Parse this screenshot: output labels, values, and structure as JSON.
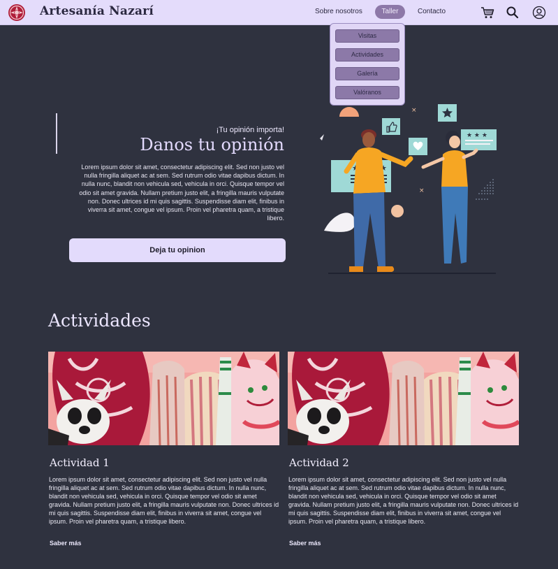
{
  "header": {
    "brand": "Artesanía Nazarí",
    "nav": [
      "Sobre nosotros",
      "Taller",
      "Contacto"
    ],
    "icons": [
      "cart-icon",
      "search-icon",
      "user-icon"
    ]
  },
  "dropdown": {
    "items": [
      "Visitas",
      "Actividades",
      "Galería",
      "Valóranos"
    ]
  },
  "hero": {
    "kicker": "¡Tu opinión importa!",
    "title": "Danos tu opinión",
    "text": "Lorem ipsum dolor sit amet, consectetur adipiscing elit. Sed non justo vel nulla fringilla aliquet ac at sem. Sed rutrum odio vitae dapibus dictum. In nulla nunc, blandit non vehicula sed, vehicula in orci. Quisque tempor vel odio sit amet gravida. Nullam pretium justo elit, a fringilla mauris vulputate non. Donec ultrices id mi quis sagittis. Suspendisse diam elit, finibus in viverra sit amet, congue vel ipsum. Proin vel pharetra quam, a tristique libero.",
    "cta": "Deja tu opinion"
  },
  "activities": {
    "title": "Actividades",
    "cards": [
      {
        "title": "Actividad 1",
        "text": "Lorem ipsum dolor sit amet, consectetur adipiscing elit. Sed non justo vel nulla fringilla aliquet ac at sem. Sed rutrum odio vitae dapibus dictum. In nulla nunc, blandit non vehicula sed, vehicula in orci. Quisque tempor vel odio sit amet gravida. Nullam pretium justo elit, a fringilla mauris vulputate non. Donec ultrices id mi quis sagittis. Suspendisse diam elit, finibus in viverra sit amet, congue vel ipsum. Proin vel pharetra quam, a tristique libero.",
        "link": "Saber más"
      },
      {
        "title": "Actividad 2",
        "text": "Lorem ipsum dolor sit amet, consectetur adipiscing elit. Sed non justo vel nulla fringilla aliquet ac at sem. Sed rutrum odio vitae dapibus dictum. In nulla nunc, blandit non vehicula sed, vehicula in orci. Quisque tempor vel odio sit amet gravida. Nullam pretium justo elit, a fringilla mauris vulputate non. Donec ultrices id mi quis sagittis. Suspendisse diam elit, finibus in viverra sit amet, congue vel ipsum. Proin vel pharetra quam, a tristique libero.",
        "link": "Saber más"
      }
    ]
  },
  "colors": {
    "background": "#2f323f",
    "header": "#e4dcfb",
    "accent": "#8d78a8",
    "brand_mark": "#b01e3a"
  }
}
